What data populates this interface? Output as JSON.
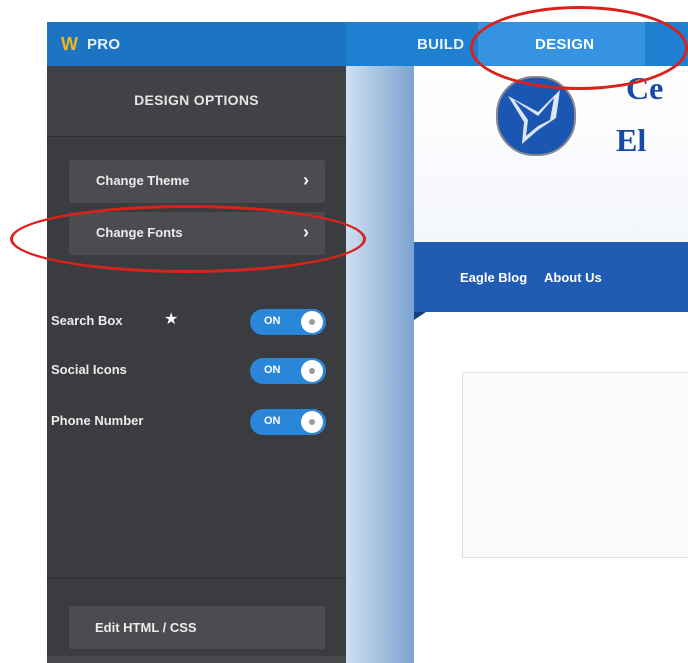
{
  "app": {
    "logo_glyph": "W",
    "plan_label": "PRO",
    "brand_color": "#1f7fd0",
    "logo_color": "#f3b51b"
  },
  "top_nav": {
    "build_label": "BUILD",
    "design_label": "DESIGN",
    "active_tab": "DESIGN"
  },
  "sidebar": {
    "header": "DESIGN OPTIONS",
    "buttons": [
      {
        "label": "Change Theme",
        "icon": "chevron-right-icon",
        "glyph": "›"
      },
      {
        "label": "Change Fonts",
        "icon": "chevron-right-icon",
        "glyph": "›"
      }
    ],
    "toggles": [
      {
        "label": "Search Box",
        "state": "ON",
        "star": "★"
      },
      {
        "label": "Social Icons",
        "state": "ON"
      },
      {
        "label": "Phone Number",
        "state": "ON"
      }
    ],
    "edit_button": "Edit HTML / CSS"
  },
  "preview": {
    "site_title_line1": "Ce",
    "site_title_line2": "El",
    "nav_links": [
      "Eagle Blog",
      "About Us"
    ]
  },
  "highlights": {
    "color": "#d8221a",
    "targets": [
      "DESIGN",
      "Change Fonts"
    ]
  }
}
